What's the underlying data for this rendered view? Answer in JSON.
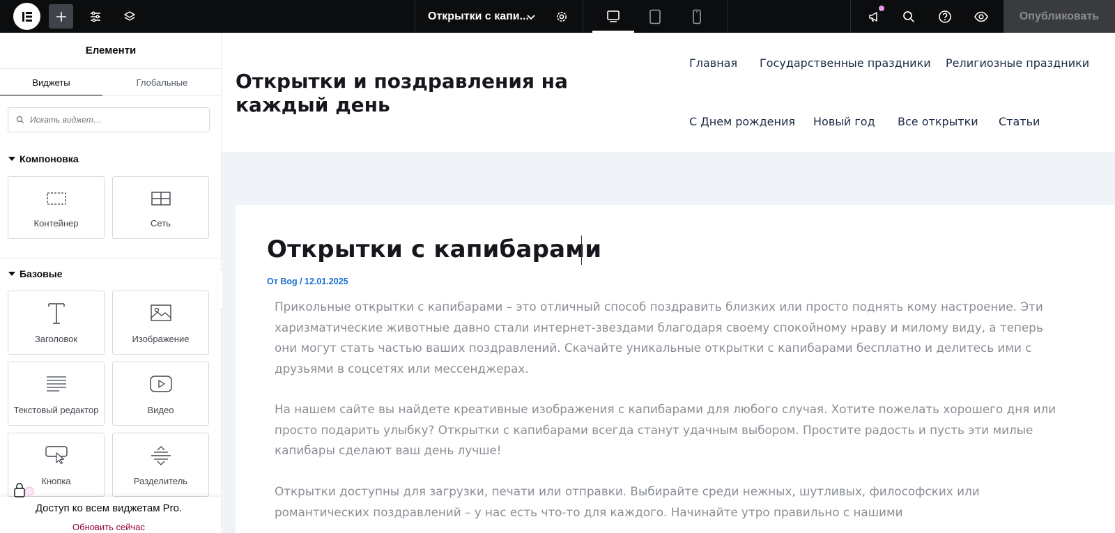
{
  "topbar": {
    "page_title": "Открытки с капи...",
    "publish_label": "Опубликовать"
  },
  "panel": {
    "title": "Елементи",
    "tabs": [
      {
        "label": "Виджеты"
      },
      {
        "label": "Глобальные"
      }
    ],
    "search_placeholder": "Искать виджет…",
    "categories": [
      {
        "label": "Компоновка",
        "widgets": [
          {
            "label": "Контейнер",
            "icon": "container-icon"
          },
          {
            "label": "Сеть",
            "icon": "grid-icon"
          }
        ]
      },
      {
        "label": "Базовые",
        "widgets": [
          {
            "label": "Заголовок",
            "icon": "heading-icon"
          },
          {
            "label": "Изображение",
            "icon": "image-icon"
          },
          {
            "label": "Текстовый редактор",
            "icon": "text-editor-icon"
          },
          {
            "label": "Видео",
            "icon": "video-icon"
          },
          {
            "label": "Кнопка",
            "icon": "button-icon"
          },
          {
            "label": "Разделитель",
            "icon": "divider-icon"
          }
        ]
      }
    ],
    "promo": {
      "text": "Доступ ко всем виджетам Pro.",
      "link": "Обновить сейчас"
    }
  },
  "site": {
    "title": "Открытки и поздравления на каждый день",
    "nav": [
      "Главная",
      "Государственные праздники",
      "Религиозные праздники",
      "С Днем рождения",
      "Новый год",
      "Все открытки",
      "Статьи"
    ]
  },
  "article": {
    "title": "Открытки с капибарами",
    "meta": "От Bog / 12.01.2025",
    "paragraphs": [
      "Прикольные открытки с капибарами – это отличный способ поздравить близких или просто поднять кому настроение. Эти харизматические животные давно стали интернет-звездами благодаря своему спокойному нраву и милому виду, а теперь они могут стать частью ваших поздравлений. Скачайте уникальные открытки с капибарами бесплатно и делитесь ими с друзьями в соцсетях или мессенджерах.",
      "На нашем сайте вы найдете креативные изображения с капибарами для любого случая. Хотите пожелать хорошего дня или просто подарить улыбку? Открытки с капибарами всегда станут удачным выбором. Простите радость и пусть эти милые капибары сделают ваш день лучше!",
      "Открытки доступны для загрузки, печати или отправки. Выбирайте среди нежных, шутливых, философских или романтических поздравлений – у нас есть что-то для каждого. Начинайте утро правильно с нашими"
    ]
  },
  "colors": {
    "topbar_bg": "#0c0d0e",
    "canvas_bg": "#f0f4f9",
    "meta_link": "#1a6fd1",
    "promo_link": "#93003f",
    "notification_dot": "#e895e8"
  }
}
